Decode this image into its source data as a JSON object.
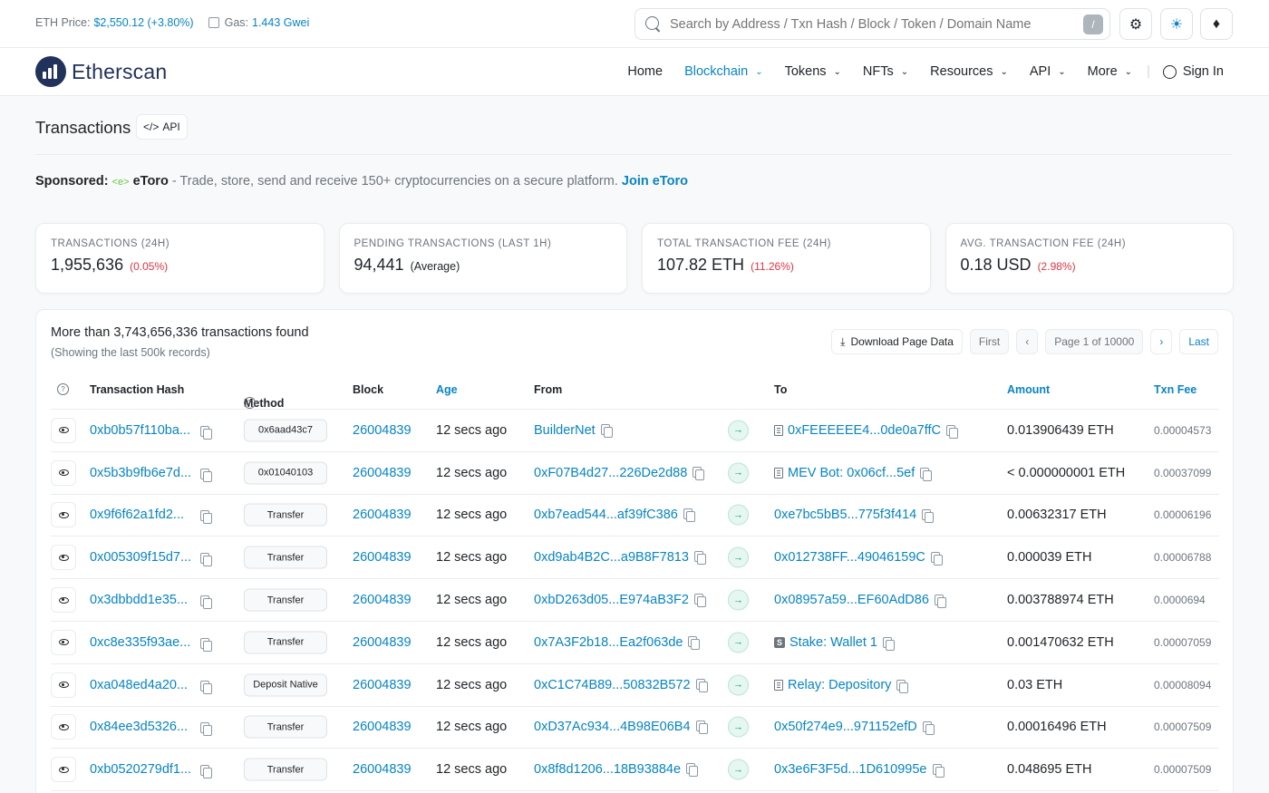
{
  "topbar": {
    "eth_price_label": "ETH Price:",
    "eth_price_value": "$2,550.12 (+3.80%)",
    "gas_label": "Gas:",
    "gas_value": "1.443 Gwei",
    "search_placeholder": "Search by Address / Txn Hash / Block / Token / Domain Name",
    "search_shortcut": "/",
    "icons": [
      "settings-icon",
      "theme-icon",
      "ethereum-icon"
    ]
  },
  "nav": {
    "brand": "Etherscan",
    "items": [
      {
        "label": "Home",
        "dropdown": false
      },
      {
        "label": "Blockchain",
        "dropdown": true,
        "active": true
      },
      {
        "label": "Tokens",
        "dropdown": true
      },
      {
        "label": "NFTs",
        "dropdown": true
      },
      {
        "label": "Resources",
        "dropdown": true
      },
      {
        "label": "API",
        "dropdown": true
      },
      {
        "label": "More",
        "dropdown": true
      }
    ],
    "sign_in": "Sign In"
  },
  "page": {
    "title": "Transactions",
    "api_label": "API"
  },
  "sponsor": {
    "label": "Sponsored:",
    "brand_glyph": "<e>",
    "brand": "eToro",
    "text": " - Trade, store, send and receive 150+ cryptocurrencies on a secure platform. ",
    "link": "Join eToro"
  },
  "stats": [
    {
      "label": "TRANSACTIONS (24H)",
      "value": "1,955,636",
      "pct": "(0.05%)"
    },
    {
      "label": "PENDING TRANSACTIONS (LAST 1H)",
      "value": "94,441",
      "note": "(Average)"
    },
    {
      "label": "TOTAL TRANSACTION FEE (24H)",
      "value": "107.82 ETH",
      "pct": "(11.26%)"
    },
    {
      "label": "AVG. TRANSACTION FEE (24H)",
      "value": "0.18 USD",
      "pct": "(2.98%)"
    }
  ],
  "table_info": {
    "found": "More than 3,743,656,336 transactions found",
    "showing": "(Showing the last 500k records)"
  },
  "pager": {
    "download": "Download Page Data",
    "first": "First",
    "page": "Page 1 of 10000",
    "last": "Last"
  },
  "columns": {
    "hash": "Transaction Hash",
    "method": "Method",
    "block": "Block",
    "age": "Age",
    "from": "From",
    "to": "To",
    "amount": "Amount",
    "fee": "Txn Fee"
  },
  "rows": [
    {
      "hash": "0xb0b57f110ba...",
      "method": "0x6aad43c7",
      "block": "26004839",
      "age": "12 secs ago",
      "from": "BuilderNet",
      "to": "0xFEEEEEE4...0de0a7ffC",
      "to_type": "contract",
      "amount": "0.013906439 ETH",
      "fee": "0.00004573"
    },
    {
      "hash": "0x5b3b9fb6e7d...",
      "method": "0x01040103",
      "block": "26004839",
      "age": "12 secs ago",
      "from": "0xF07B4d27...226De2d88",
      "to": "MEV Bot: 0x06cf...5ef",
      "to_type": "contract",
      "amount": "< 0.000000001 ETH",
      "fee": "0.00037099"
    },
    {
      "hash": "0x9f6f62a1fd2...",
      "method": "Transfer",
      "block": "26004839",
      "age": "12 secs ago",
      "from": "0xb7ead544...af39fC386",
      "to": "0xe7bc5bB5...775f3f414",
      "to_type": "",
      "amount": "0.00632317 ETH",
      "fee": "0.00006196"
    },
    {
      "hash": "0x005309f15d7...",
      "method": "Transfer",
      "block": "26004839",
      "age": "12 secs ago",
      "from": "0xd9ab4B2C...a9B8F7813",
      "to": "0x012738FF...49046159C",
      "to_type": "",
      "amount": "0.000039 ETH",
      "fee": "0.00006788"
    },
    {
      "hash": "0x3dbbdd1e35...",
      "method": "Transfer",
      "block": "26004839",
      "age": "12 secs ago",
      "from": "0xbD263d05...E974aB3F2",
      "to": "0x08957a59...EF60AdD86",
      "to_type": "",
      "amount": "0.003788974 ETH",
      "fee": "0.0000694"
    },
    {
      "hash": "0xc8e335f93ae...",
      "method": "Transfer",
      "block": "26004839",
      "age": "12 secs ago",
      "from": "0x7A3F2b18...Ea2f063de",
      "to": "Stake: Wallet 1",
      "to_type": "stake",
      "amount": "0.001470632 ETH",
      "fee": "0.00007059"
    },
    {
      "hash": "0xa048ed4a20...",
      "method": "Deposit Native",
      "block": "26004839",
      "age": "12 secs ago",
      "from": "0xC1C74B89...50832B572",
      "to": "Relay: Depository",
      "to_type": "contract",
      "amount": "0.03 ETH",
      "fee": "0.00008094"
    },
    {
      "hash": "0x84ee3d5326...",
      "method": "Transfer",
      "block": "26004839",
      "age": "12 secs ago",
      "from": "0xD37Ac934...4B98E06B4",
      "to": "0x50f274e9...971152efD",
      "to_type": "",
      "amount": "0.00016496 ETH",
      "fee": "0.00007509"
    },
    {
      "hash": "0xb0520279df1...",
      "method": "Transfer",
      "block": "26004839",
      "age": "12 secs ago",
      "from": "0x8f8d1206...18B93884e",
      "to": "0x3e6F3F5d...1D610995e",
      "to_type": "",
      "amount": "0.048695 ETH",
      "fee": "0.00007509"
    }
  ]
}
